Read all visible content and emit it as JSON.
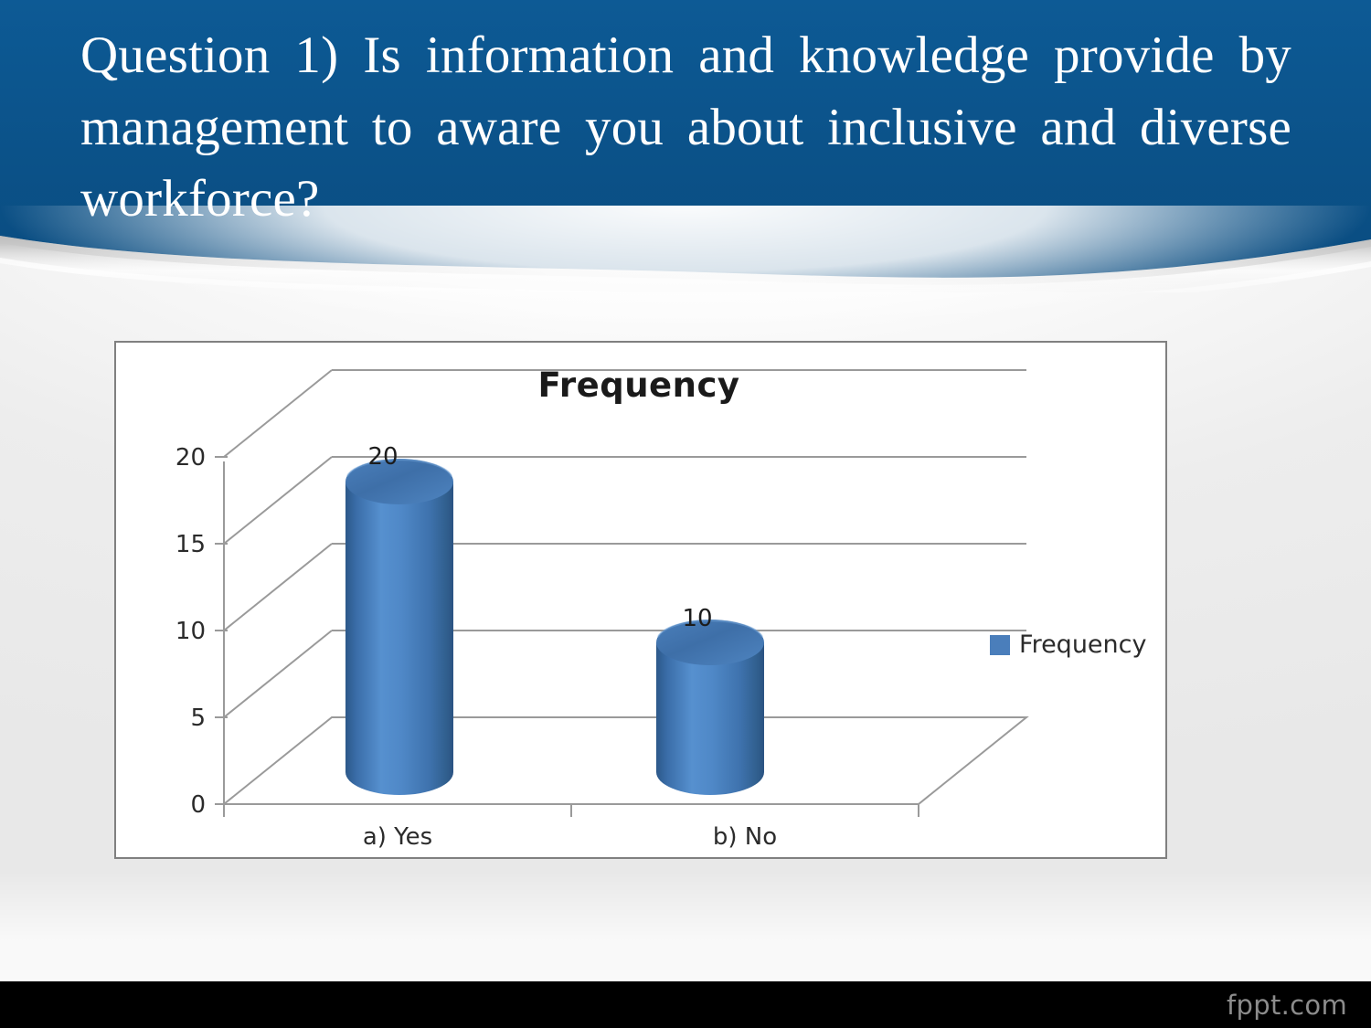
{
  "slide": {
    "title": "Question 1) Is information and knowledge provide by management to aware you about inclusive and diverse workforce?",
    "header_color": "#0b5289",
    "background_color": "#ededed"
  },
  "footer": {
    "watermark": "fppt.com",
    "bar_color": "#000000",
    "text_color": "#8c8c8c"
  },
  "chart_data": {
    "type": "bar",
    "title": "Frequency",
    "categories": [
      "a)    Yes",
      "b)    No"
    ],
    "values": [
      20,
      10
    ],
    "data_labels": [
      "20",
      "10"
    ],
    "series": [
      {
        "name": "Frequency",
        "values": [
          20,
          10
        ],
        "color": "#4a7ebb"
      }
    ],
    "legend": {
      "position": "right",
      "entries": [
        {
          "label": "Frequency",
          "color": "#4a7ebb"
        }
      ]
    },
    "xlabel": "",
    "ylabel": "",
    "ylim": [
      0,
      20
    ],
    "yticks": [
      "0",
      "5",
      "10",
      "15",
      "20"
    ],
    "ytick_values": [
      0,
      5,
      10,
      15,
      20
    ],
    "grid": true,
    "three_d": true,
    "bar_shape": "cylinder",
    "bar_fill_light": "#5b90cd",
    "bar_fill_dark": "#2e5b8e",
    "axis_line_color": "#9a9a9a",
    "plot_background": "#ffffff"
  }
}
